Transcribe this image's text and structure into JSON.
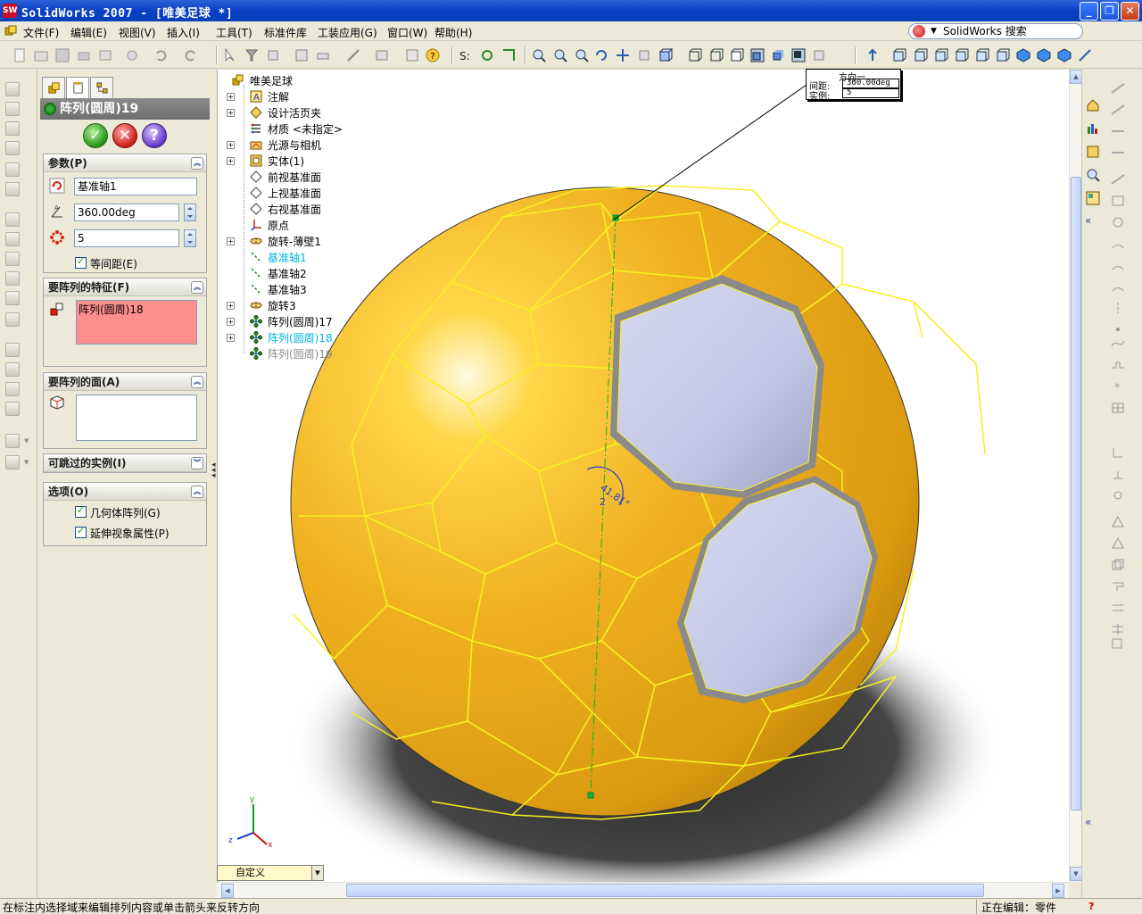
{
  "window": {
    "title": "SolidWorks 2007 - [唯美足球 *]",
    "app_icon": "SW"
  },
  "menu": {
    "items": [
      "文件(F)",
      "编辑(E)",
      "视图(V)",
      "插入(I)",
      "工具(T)",
      "标准件库",
      "工装应用(G)",
      "窗口(W)",
      "帮助(H)"
    ],
    "search_label": "SolidWorks 搜索"
  },
  "property_manager": {
    "title": "阵列(圆周)19",
    "params_group": {
      "title": "参数(P)",
      "axis_value": "基准轴1",
      "angle_value": "360.00deg",
      "instances_value": "5",
      "equal_spacing_label": "等间距(E)"
    },
    "features_group": {
      "title": "要阵列的特征(F)",
      "item": "阵列(圆周)18"
    },
    "faces_group": {
      "title": "要阵列的面(A)"
    },
    "skip_group": {
      "title": "可跳过的实例(I)"
    },
    "options_group": {
      "title": "选项(O)",
      "geometry_pattern_label": "几何体阵列(G)",
      "propagate_label": "延伸视象属性(P)"
    }
  },
  "feature_tree": {
    "root": "唯美足球",
    "items": [
      {
        "label": "注解",
        "icon": "annotation-icon",
        "expandable": true
      },
      {
        "label": "设计活页夹",
        "icon": "design-binder-icon",
        "expandable": true
      },
      {
        "label": "材质 <未指定>",
        "icon": "material-icon",
        "expandable": false
      },
      {
        "label": "光源与相机",
        "icon": "lights-icon",
        "expandable": true
      },
      {
        "label": "实体(1)",
        "icon": "solid-bodies-icon",
        "expandable": true
      },
      {
        "label": "前视基准面",
        "icon": "plane-icon",
        "expandable": false
      },
      {
        "label": "上视基准面",
        "icon": "plane-icon",
        "expandable": false
      },
      {
        "label": "右视基准面",
        "icon": "plane-icon",
        "expandable": false
      },
      {
        "label": "原点",
        "icon": "origin-icon",
        "expandable": false
      },
      {
        "label": "旋转-薄壁1",
        "icon": "revolve-icon",
        "expandable": true
      },
      {
        "label": "基准轴1",
        "icon": "axis-icon",
        "expandable": false,
        "highlight": true
      },
      {
        "label": "基准轴2",
        "icon": "axis-icon",
        "expandable": false
      },
      {
        "label": "基准轴3",
        "icon": "axis-icon",
        "expandable": false
      },
      {
        "label": "旋转3",
        "icon": "revolve-icon",
        "expandable": true
      },
      {
        "label": "阵列(圆周)17",
        "icon": "circular-pattern-icon",
        "expandable": true
      },
      {
        "label": "阵列(圆周)18",
        "icon": "circular-pattern-icon",
        "expandable": true,
        "highlight": true
      },
      {
        "label": "阵列(圆周)19",
        "icon": "circular-pattern-icon",
        "expandable": false,
        "greyed": true
      }
    ]
  },
  "callout": {
    "title": "方向一",
    "spacing_label": "间距:",
    "spacing_value": "360.00deg",
    "instances_label": "实例:",
    "instances_value": "5"
  },
  "viewport": {
    "angle_annotation": "41.81°",
    "index_annotation": "2",
    "ball_color": "#f0b020",
    "panel_color": "#c8cbe8"
  },
  "config_select": "自定义",
  "status": {
    "message": "在标注内选择域来编辑排列内容或单击箭头来反转方向",
    "editing": "正在编辑：零件"
  },
  "colors": {
    "accent_blue": "#0a3ec3",
    "pm_header": "#7a7a7a",
    "highlight_cyan": "#00b4e6"
  }
}
